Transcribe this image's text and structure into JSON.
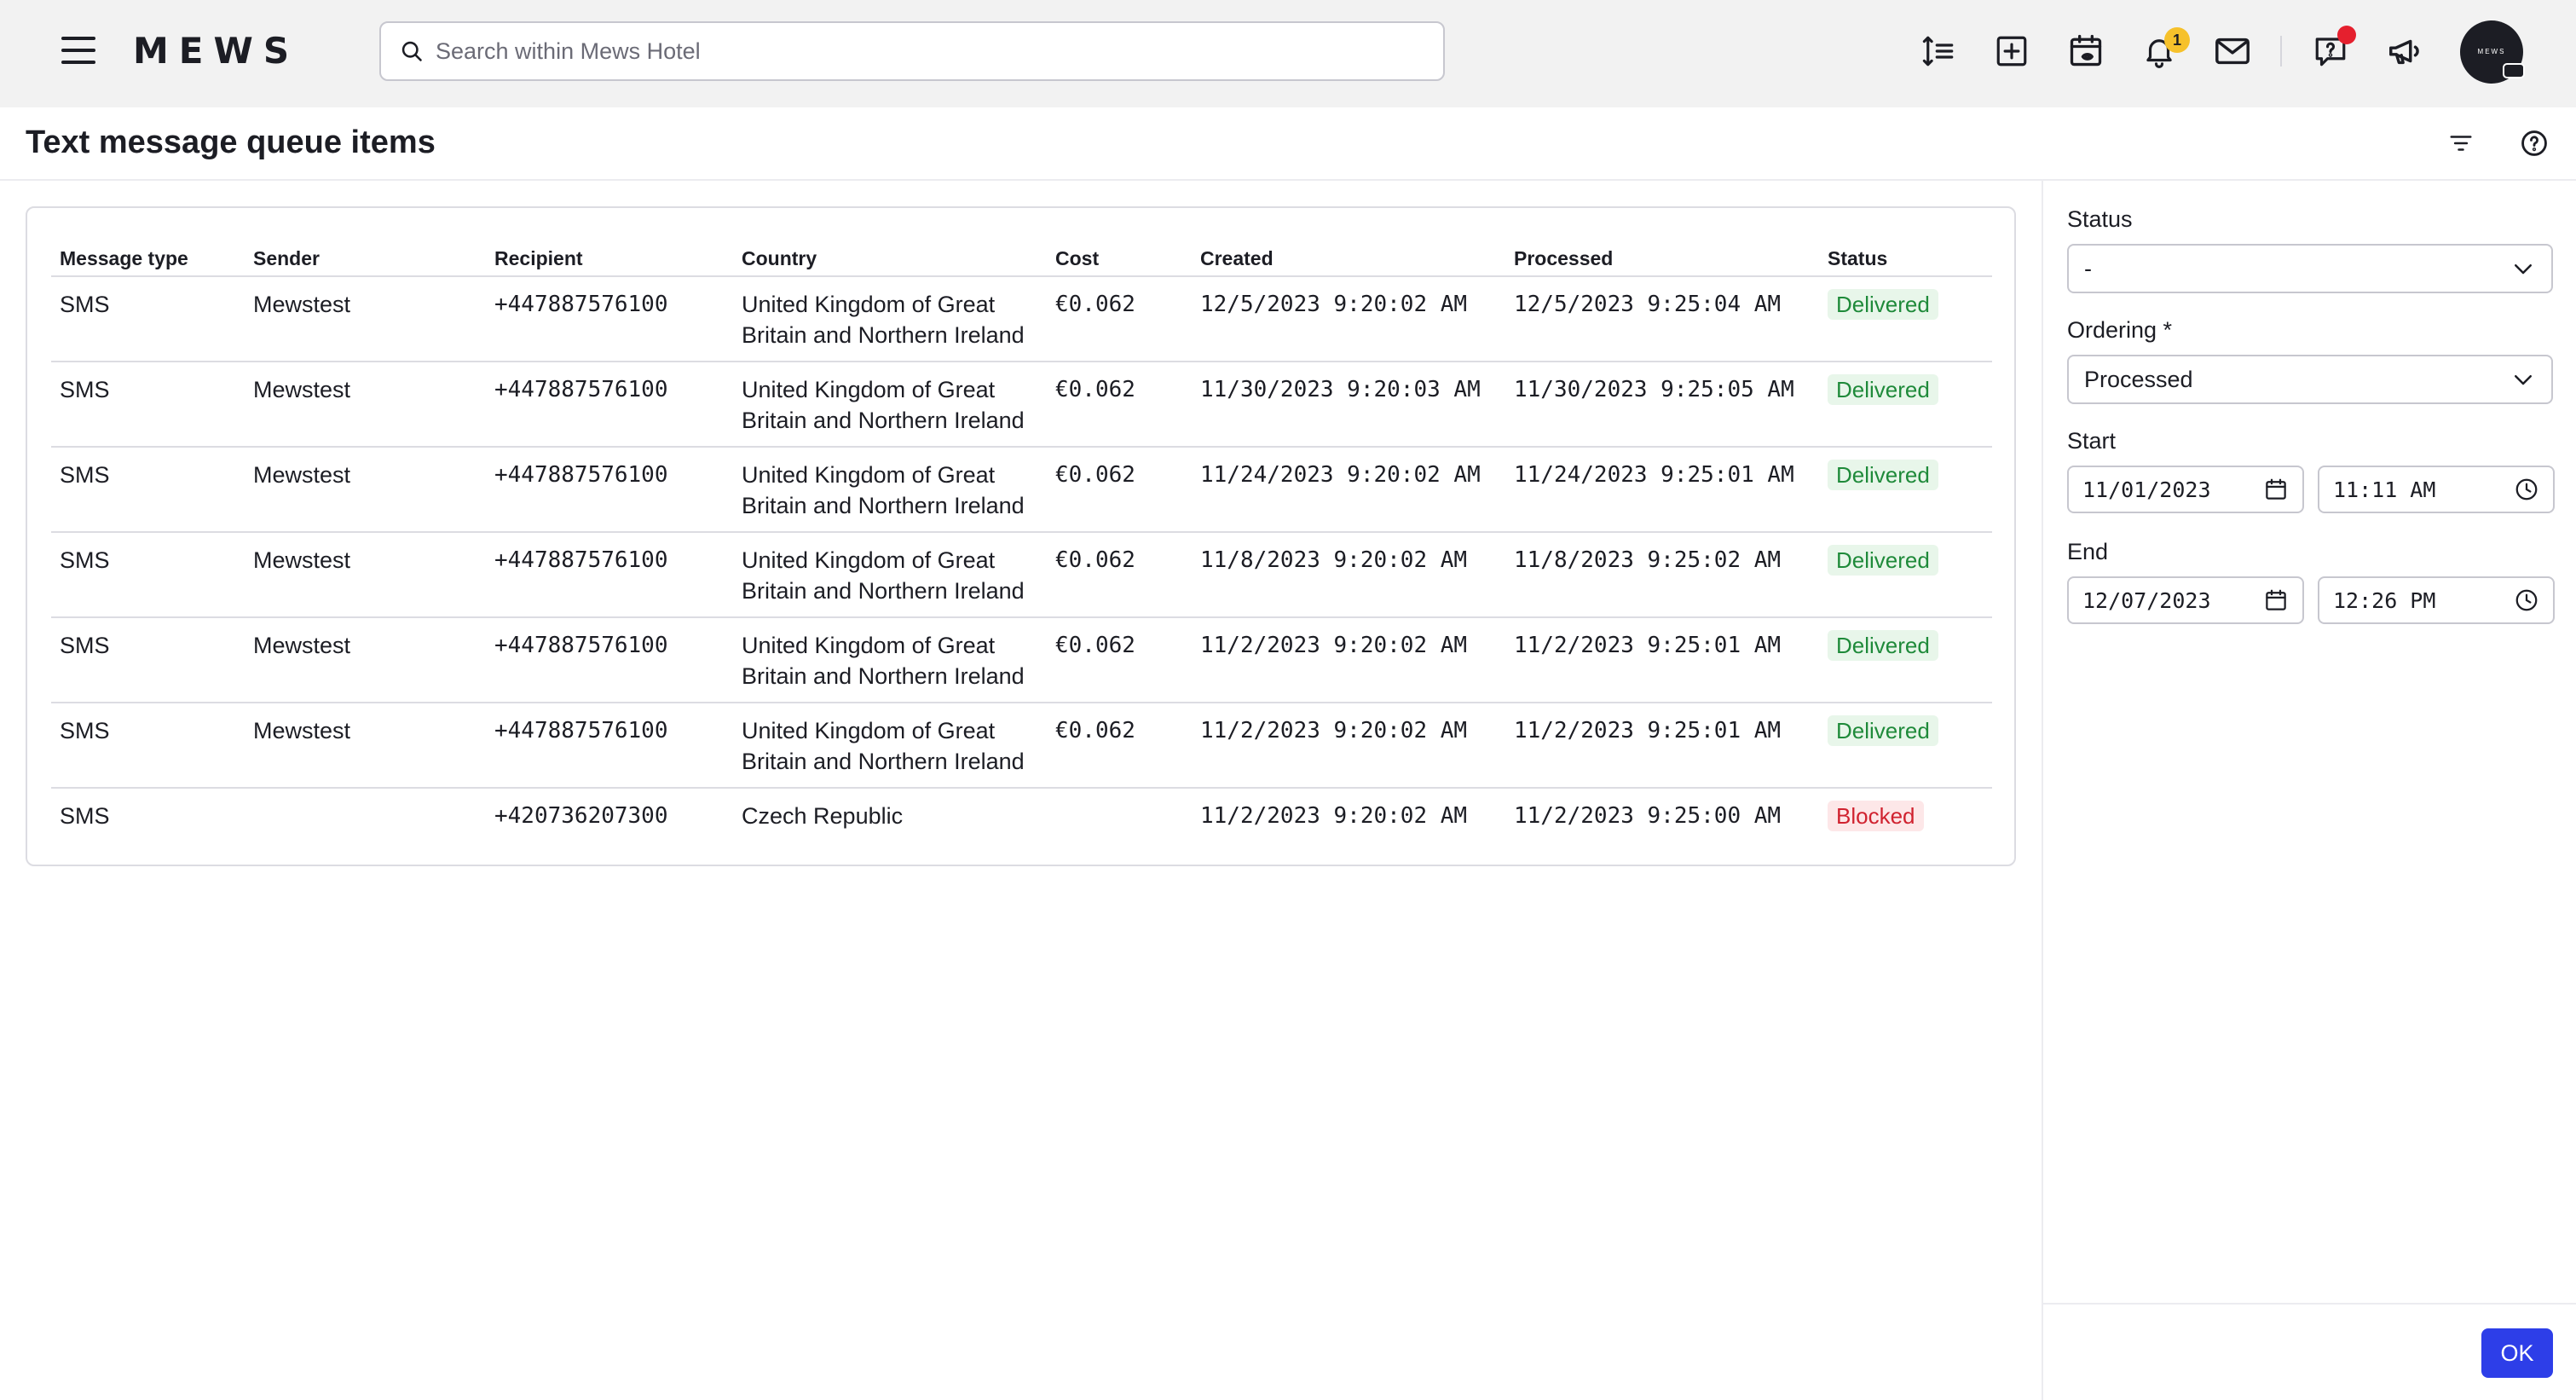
{
  "app": {
    "logo_text": "MEWS",
    "search_placeholder": "Search within Mews Hotel",
    "notifications_count": "1",
    "avatar_text": "MEWS"
  },
  "toolbar_icons": [
    "line-height-icon",
    "add-box-icon",
    "calendar-eye-icon",
    "bell-icon",
    "mail-icon",
    "help-chat-icon",
    "megaphone-icon"
  ],
  "page": {
    "title": "Text message queue items"
  },
  "table": {
    "columns": [
      "Message type",
      "Sender",
      "Recipient",
      "Country",
      "Cost",
      "Created",
      "Processed",
      "Status"
    ],
    "rows": [
      {
        "type": "SMS",
        "sender": "Mewstest",
        "recipient": "+447887576100",
        "country": "United Kingdom of Great Britain and Northern Ireland",
        "cost": "€0.062",
        "created": "12/5/2023 9:20:02 AM",
        "processed": "12/5/2023 9:25:04 AM",
        "status": "Delivered"
      },
      {
        "type": "SMS",
        "sender": "Mewstest",
        "recipient": "+447887576100",
        "country": "United Kingdom of Great Britain and Northern Ireland",
        "cost": "€0.062",
        "created": "11/30/2023 9:20:03 AM",
        "processed": "11/30/2023 9:25:05 AM",
        "status": "Delivered"
      },
      {
        "type": "SMS",
        "sender": "Mewstest",
        "recipient": "+447887576100",
        "country": "United Kingdom of Great Britain and Northern Ireland",
        "cost": "€0.062",
        "created": "11/24/2023 9:20:02 AM",
        "processed": "11/24/2023 9:25:01 AM",
        "status": "Delivered"
      },
      {
        "type": "SMS",
        "sender": "Mewstest",
        "recipient": "+447887576100",
        "country": "United Kingdom of Great Britain and Northern Ireland",
        "cost": "€0.062",
        "created": "11/8/2023 9:20:02 AM",
        "processed": "11/8/2023 9:25:02 AM",
        "status": "Delivered"
      },
      {
        "type": "SMS",
        "sender": "Mewstest",
        "recipient": "+447887576100",
        "country": "United Kingdom of Great Britain and Northern Ireland",
        "cost": "€0.062",
        "created": "11/2/2023 9:20:02 AM",
        "processed": "11/2/2023 9:25:01 AM",
        "status": "Delivered"
      },
      {
        "type": "SMS",
        "sender": "Mewstest",
        "recipient": "+447887576100",
        "country": "United Kingdom of Great Britain and Northern Ireland",
        "cost": "€0.062",
        "created": "11/2/2023 9:20:02 AM",
        "processed": "11/2/2023 9:25:01 AM",
        "status": "Delivered"
      },
      {
        "type": "SMS",
        "sender": "",
        "recipient": "+420736207300",
        "country": "Czech Republic",
        "cost": "",
        "created": "11/2/2023 9:20:02 AM",
        "processed": "11/2/2023 9:25:00 AM",
        "status": "Blocked"
      }
    ]
  },
  "filters": {
    "status_label": "Status",
    "status_value": "-",
    "ordering_label": "Ordering *",
    "ordering_value": "Processed",
    "start_label": "Start",
    "start_date": "11/01/2023",
    "start_time": "11:11 AM",
    "end_label": "End",
    "end_date": "12/07/2023",
    "end_time": "12:26 PM",
    "ok_label": "OK"
  },
  "colors": {
    "accent": "#2d3ee8",
    "delivered_text": "#1f8a3a",
    "delivered_bg": "#e8f6ea",
    "blocked_text": "#d0222f",
    "blocked_bg": "#fde7e8",
    "badge": "#f6c12b",
    "alert_dot": "#e5202e"
  }
}
